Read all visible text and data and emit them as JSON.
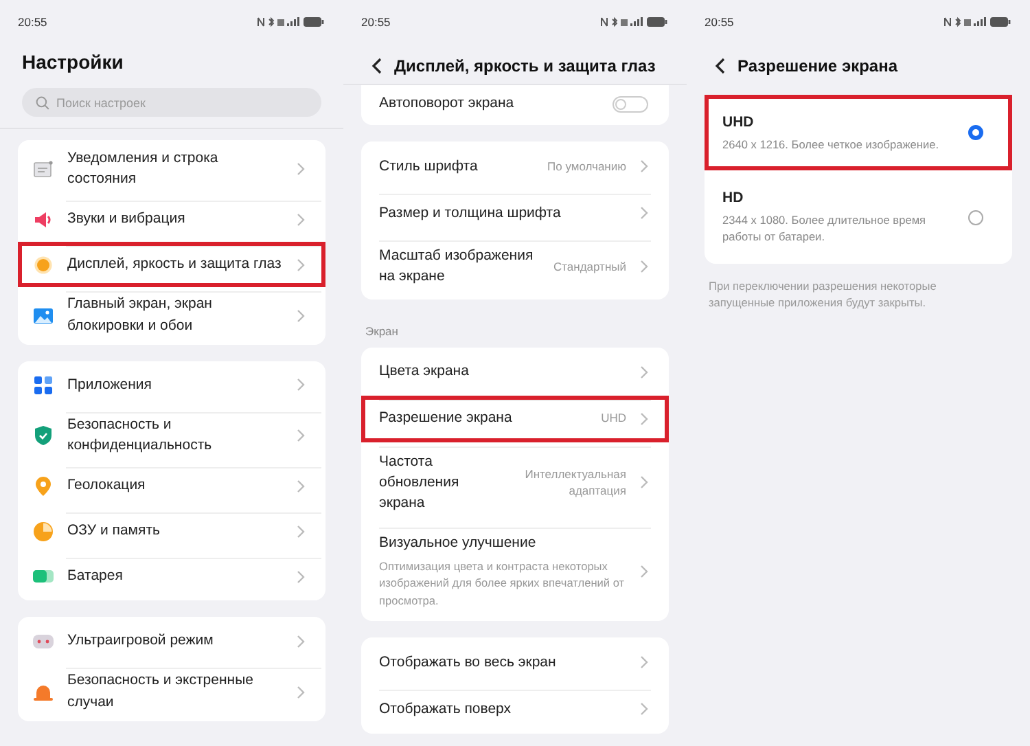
{
  "settings_screen": {
    "status_time": "20:55",
    "title": "Настройки",
    "search": {
      "placeholder": "Поиск настроек"
    },
    "groups": [
      [
        {
          "label": "Уведомления и строка состояния",
          "highlighted": false
        },
        {
          "label": "Звуки и вибрация",
          "highlighted": false
        },
        {
          "label": "Дисплей, яркость и защита глаз",
          "highlighted": true
        },
        {
          "label": "Главный экран, экран блокировки и обои",
          "highlighted": false
        }
      ],
      [
        {
          "label": "Приложения",
          "highlighted": false
        },
        {
          "label": "Безопасность и конфиденциальность",
          "highlighted": false
        },
        {
          "label": "Геолокация",
          "highlighted": false
        },
        {
          "label": "ОЗУ и память",
          "highlighted": false
        },
        {
          "label": "Батарея",
          "highlighted": false
        }
      ],
      [
        {
          "label": "Ультраигровой режим",
          "highlighted": false
        },
        {
          "label": "Безопасность и экстренные случаи",
          "highlighted": false
        }
      ]
    ]
  },
  "display_screen": {
    "status_time": "20:55",
    "title": "Дисплей, яркость и защита глаз",
    "groups": [
      {
        "items": [
          {
            "kind": "toggle",
            "label": "Автоповорот экрана",
            "on": false
          }
        ]
      },
      {
        "items": [
          {
            "kind": "link",
            "label": "Стиль шрифта",
            "value": "По умолчанию",
            "highlighted": false
          },
          {
            "kind": "link",
            "label": "Размер и толщина шрифта",
            "highlighted": false
          },
          {
            "kind": "link",
            "label": "Масштаб изображения на экране",
            "value": "Стандартный",
            "highlighted": false
          }
        ]
      },
      {
        "heading": "Экран",
        "items": [
          {
            "kind": "link",
            "label": "Цвета экрана",
            "highlighted": false
          },
          {
            "kind": "link",
            "label": "Разрешение экрана",
            "value": "UHD",
            "highlighted": true
          },
          {
            "kind": "link",
            "label": "Частота обновления экрана",
            "value": "Интеллектуальная адаптация",
            "highlighted": false
          },
          {
            "kind": "link",
            "label": "Визуальное улучшение",
            "subtitle": "Оптимизация цвета и контраста некоторых изображений для более ярких впечатлений от просмотра.",
            "highlighted": false
          }
        ]
      },
      {
        "items": [
          {
            "kind": "link",
            "label": "Отображать во весь экран",
            "highlighted": false
          },
          {
            "kind": "link",
            "label": "Отображать поверх",
            "highlighted": false
          }
        ]
      }
    ]
  },
  "resolution_screen": {
    "status_time": "20:55",
    "title": "Разрешение экрана",
    "options": [
      {
        "label": "UHD",
        "description": "2640 x 1216. Более четкое изображение.",
        "selected": true,
        "highlighted": true
      },
      {
        "label": "HD",
        "description": "2344 x 1080. Более длительное время работы от батареи.",
        "selected": false,
        "highlighted": false
      }
    ],
    "note": "При переключении разрешения некоторые запущенные приложения будут закрыты."
  }
}
